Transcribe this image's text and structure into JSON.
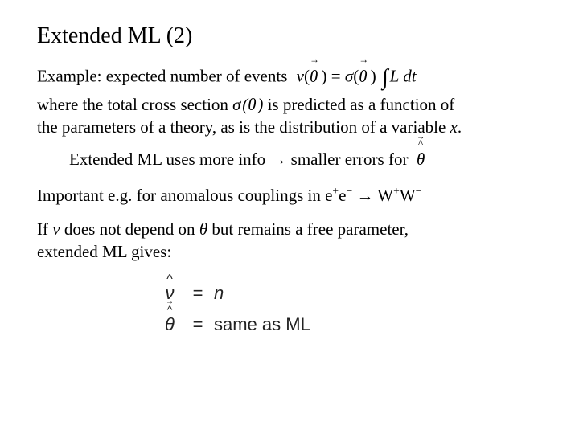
{
  "title": "Extended ML (2)",
  "p1a": "Example:  expected number of events",
  "p1b": "where the total cross section ",
  "p1c": " is predicted as a function of",
  "p1d": "the parameters of a theory, as is the distribution of a variable ",
  "p1e": ".",
  "sigma_theta": "σ (θ )",
  "var_x": "x",
  "p2": "Extended ML uses more info → smaller errors for",
  "p3a": "Important e.g. for anomalous couplings in e",
  "p3b": "e",
  "p3c": " → W",
  "p3d": "W",
  "plus": "+",
  "minus": "−",
  "p4a": "If ",
  "nu": "ν",
  "p4b": " does not depend on ",
  "theta": "θ",
  "p4c": " but remains a free parameter,",
  "p4d": "extended ML gives:",
  "eq_nu_lhs": "ν",
  "eq_nu_rhs": "n",
  "eq_th_lhs": "θ",
  "eq_th_rhs": "same as ML",
  "eq_eq": "=",
  "int": "∫",
  "Ldt": "L dt",
  "f_nu": "ν",
  "f_sigma": "σ",
  "f_theta": "θ"
}
